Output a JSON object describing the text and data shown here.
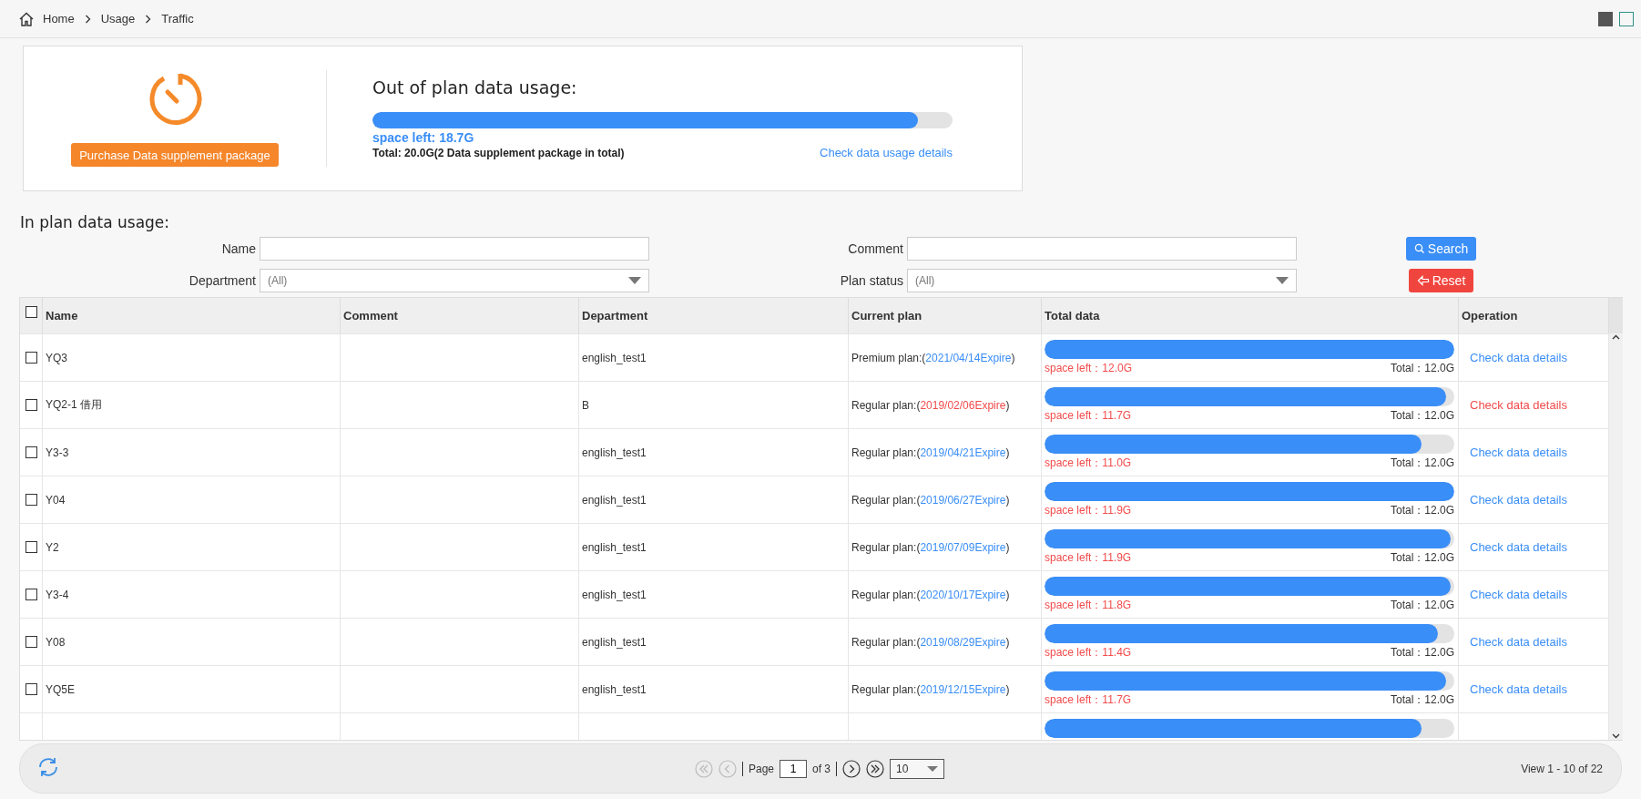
{
  "breadcrumb": [
    "Home",
    "Usage",
    "Traffic"
  ],
  "out_of_plan": {
    "button": "Purchase Data supplement package",
    "title": "Out of plan data usage:",
    "level": 0.94,
    "space_left": "space left: 18.7G",
    "total": "Total: 20.0G(2 Data supplement package in total)",
    "link": "Check data usage details"
  },
  "in_plan_title": "In plan data usage:",
  "filters": [
    {
      "kind": "text",
      "label": "Name"
    },
    {
      "kind": "text",
      "label": "Comment"
    },
    {
      "kind": "select",
      "label": "Department",
      "value": "(All)"
    },
    {
      "kind": "select",
      "label": "Plan status",
      "value": "(All)"
    }
  ],
  "buttons": [
    {
      "kind": "search",
      "label": "Search"
    },
    {
      "kind": "reset",
      "label": "Reset"
    }
  ],
  "table": {
    "header_checked": false,
    "columns": [
      "Name",
      "Comment",
      "Department",
      "Current plan",
      "Total data",
      "Operation"
    ],
    "rows": [
      {
        "checked": false,
        "name": "YQ3",
        "department": "english_test1",
        "plan": "Premium plan:(",
        "expire_date": "2021/04/14Expire",
        "suffix": ")",
        "expired": false,
        "level": 1.0,
        "space_left": "space left：12.0G",
        "total": "Total：12.0G",
        "action": "Check data details"
      },
      {
        "checked": false,
        "name": "YQ2-1 借用",
        "department": "B",
        "plan": "Regular plan:(",
        "expire_date": "2019/02/06Expire",
        "suffix": ")",
        "expired": true,
        "level": 0.98,
        "space_left": "space left：11.7G",
        "total": "Total：12.0G",
        "action": "Check data details"
      },
      {
        "checked": false,
        "name": "Y3-3",
        "department": "english_test1",
        "plan": "Regular plan:(",
        "expire_date": "2019/04/21Expire",
        "suffix": ")",
        "expired": false,
        "level": 0.92,
        "space_left": "space left：11.0G",
        "total": "Total：12.0G",
        "action": "Check data details"
      },
      {
        "checked": false,
        "name": "Y04",
        "department": "english_test1",
        "plan": "Regular plan:(",
        "expire_date": "2019/06/27Expire",
        "suffix": ")",
        "expired": false,
        "level": 1.0,
        "space_left": "space left：11.9G",
        "total": "Total：12.0G",
        "action": "Check data details"
      },
      {
        "checked": false,
        "name": "Y2",
        "department": "english_test1",
        "plan": "Regular plan:(",
        "expire_date": "2019/07/09Expire",
        "suffix": ")",
        "expired": false,
        "level": 0.99,
        "space_left": "space left：11.9G",
        "total": "Total：12.0G",
        "action": "Check data details"
      },
      {
        "checked": false,
        "name": "Y3-4",
        "department": "english_test1",
        "plan": "Regular plan:(",
        "expire_date": "2020/10/17Expire",
        "suffix": ")",
        "expired": false,
        "level": 0.99,
        "space_left": "space left：11.8G",
        "total": "Total：12.0G",
        "action": "Check data details"
      },
      {
        "checked": false,
        "name": "Y08",
        "department": "english_test1",
        "plan": "Regular plan:(",
        "expire_date": "2019/08/29Expire",
        "suffix": ")",
        "expired": false,
        "level": 0.96,
        "space_left": "space left：11.4G",
        "total": "Total：12.0G",
        "action": "Check data details"
      },
      {
        "checked": false,
        "name": "YQ5E",
        "department": "english_test1",
        "plan": "Regular plan:(",
        "expire_date": "2019/12/15Expire",
        "suffix": ")",
        "expired": false,
        "level": 0.98,
        "space_left": "space left：11.7G",
        "total": "Total：12.0G",
        "action": "Check data details"
      },
      {
        "kind": "partial",
        "level": 0.92
      }
    ]
  },
  "pagination": {
    "page_label": "Page",
    "page": "1",
    "of": "of 3",
    "page_size": "10",
    "first_disabled": true,
    "prev_disabled": true,
    "summary": "View 1 - 10 of 22"
  }
}
